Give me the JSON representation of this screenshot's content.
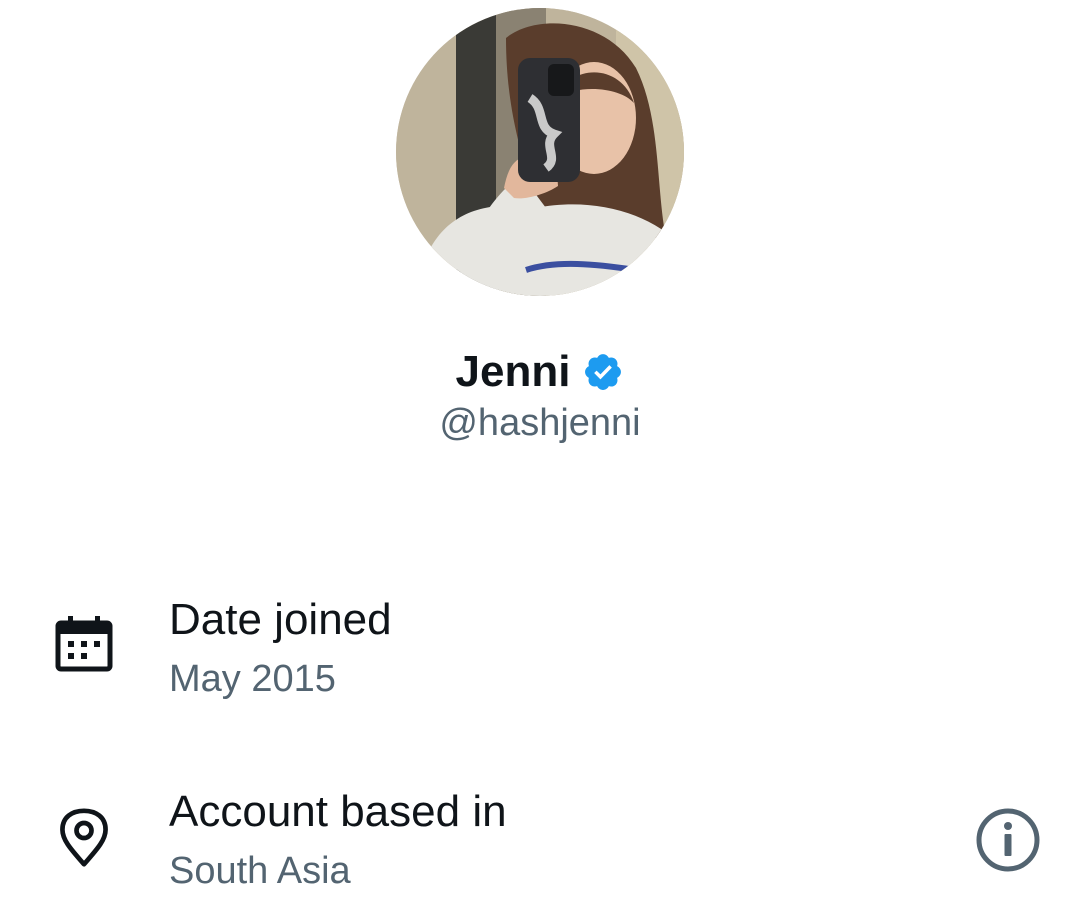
{
  "profile": {
    "display_name": "Jenni",
    "handle": "@hashjenni",
    "verified": true
  },
  "details": {
    "date_joined_label": "Date joined",
    "date_joined_value": "May 2015",
    "location_label": "Account based in",
    "location_value": "South Asia"
  },
  "colors": {
    "verified": "#1d9bf0",
    "primary_text": "#0f1419",
    "secondary_text": "#536471"
  },
  "icons": {
    "date": "calendar-icon",
    "location": "location-pin-icon",
    "info": "info-icon",
    "verified": "verified-badge-icon"
  }
}
